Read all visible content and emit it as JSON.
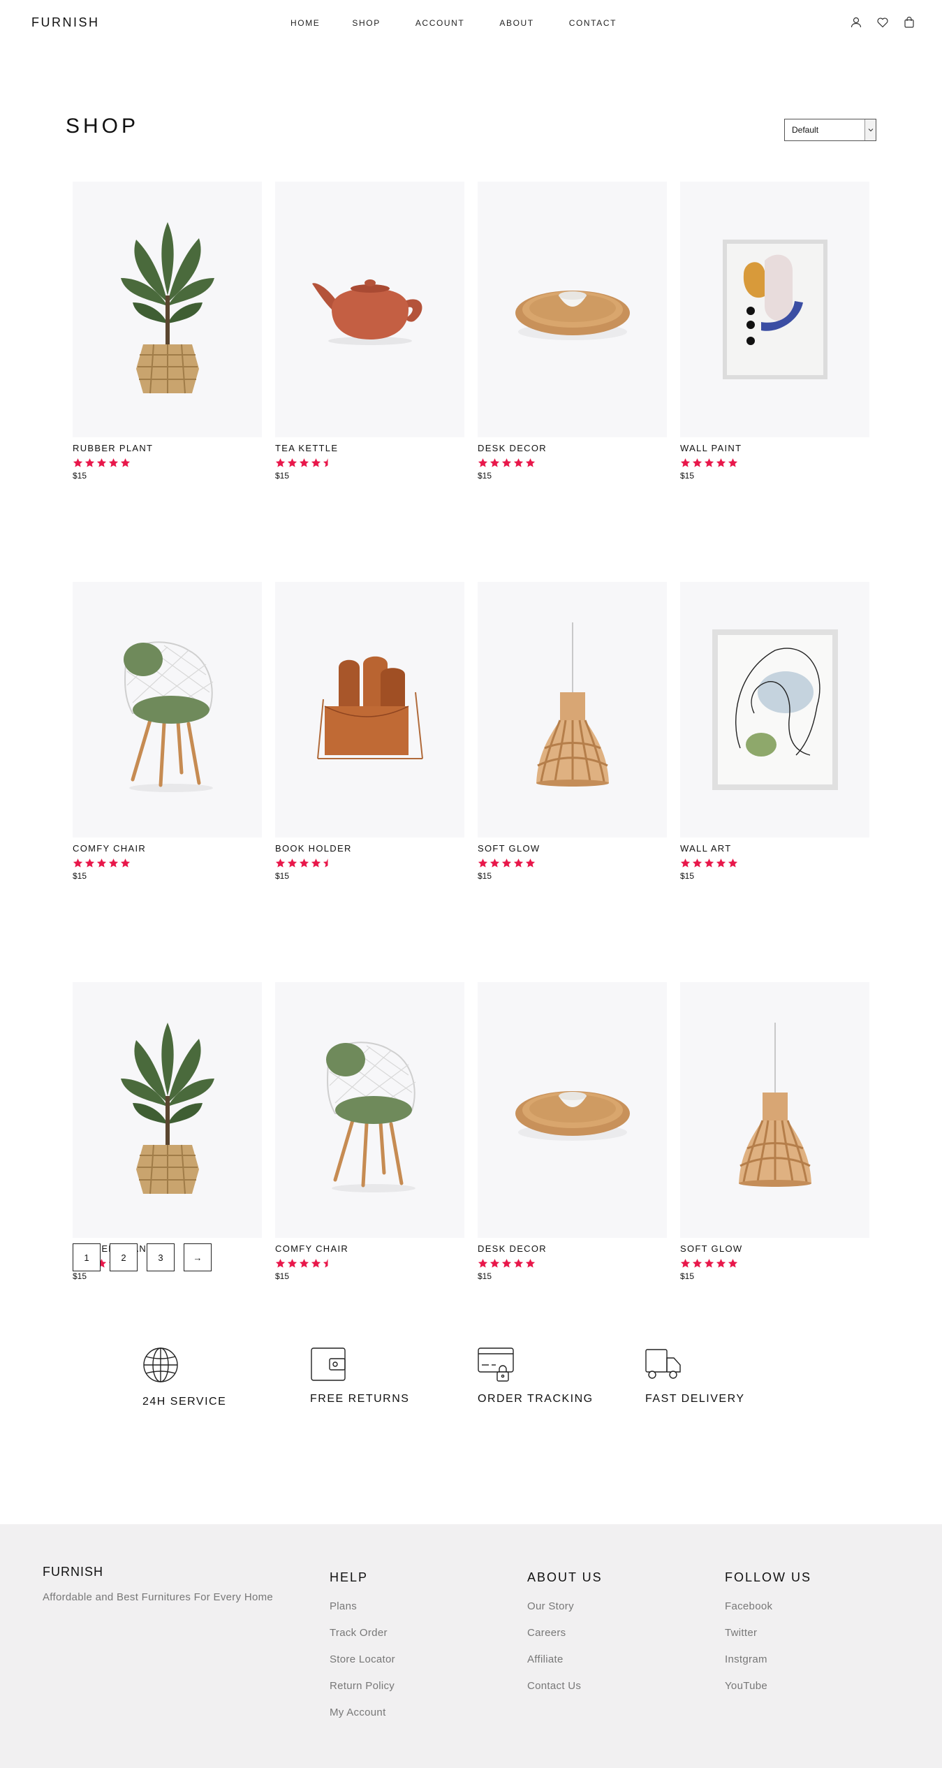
{
  "header": {
    "logo": "FURNISH",
    "nav": [
      "HOME",
      "SHOP",
      "ACCOUNT",
      "ABOUT",
      "CONTACT"
    ],
    "icons": [
      "user-icon",
      "heart-icon",
      "cart-icon"
    ]
  },
  "shop": {
    "title": "SHOP",
    "sort_value": "Default"
  },
  "products": [
    {
      "name": "RUBBER PLANT",
      "price": "$15",
      "rating": 5,
      "image": "plant"
    },
    {
      "name": "TEA KETTLE",
      "price": "$15",
      "rating": 4.5,
      "image": "kettle"
    },
    {
      "name": "DESK DECOR",
      "price": "$15",
      "rating": 5,
      "image": "bowl"
    },
    {
      "name": "WALL PAINT",
      "price": "$15",
      "rating": 5,
      "image": "wallpaint"
    },
    {
      "name": "COMFY CHAIR",
      "price": "$15",
      "rating": 5,
      "image": "chair"
    },
    {
      "name": "BOOK HOLDER",
      "price": "$15",
      "rating": 4.5,
      "image": "bookholder"
    },
    {
      "name": "SOFT GLOW",
      "price": "$15",
      "rating": 5,
      "image": "lamp"
    },
    {
      "name": "WALL ART",
      "price": "$15",
      "rating": 5,
      "image": "wallart"
    },
    {
      "name": "RUBBER PLANT",
      "price": "$15",
      "rating": 5,
      "image": "plant"
    },
    {
      "name": "COMFY CHAIR",
      "price": "$15",
      "rating": 4.5,
      "image": "chair"
    },
    {
      "name": "DESK DECOR",
      "price": "$15",
      "rating": 5,
      "image": "bowl"
    },
    {
      "name": "SOFT GLOW",
      "price": "$15",
      "rating": 5,
      "image": "lamp"
    }
  ],
  "pagination": [
    "1",
    "2",
    "3",
    "→"
  ],
  "features": [
    {
      "label": "24H SERVICE",
      "icon": "globe-icon"
    },
    {
      "label": "FREE RETURNS",
      "icon": "wallet-icon"
    },
    {
      "label": "ORDER TRACKING",
      "icon": "card-lock-icon"
    },
    {
      "label": "FAST DELIVERY",
      "icon": "truck-icon"
    }
  ],
  "footer": {
    "logo": "FURNISH",
    "tagline": "Affordable and Best Furnitures For Every Home",
    "columns": [
      {
        "title": "HELP",
        "links": [
          "Plans",
          "Track Order",
          "Store Locator",
          "Return Policy",
          "My Account"
        ]
      },
      {
        "title": "ABOUT US",
        "links": [
          "Our Story",
          "Careers",
          "Affiliate",
          "Contact Us"
        ]
      },
      {
        "title": "FOLLOW US",
        "links": [
          "Facebook",
          "Twitter",
          "Instgram",
          "YouTube"
        ]
      }
    ]
  },
  "colors": {
    "star": "#e8174a",
    "card_bg": "#f7f7f9",
    "footer_bg": "#f1f0f1"
  }
}
